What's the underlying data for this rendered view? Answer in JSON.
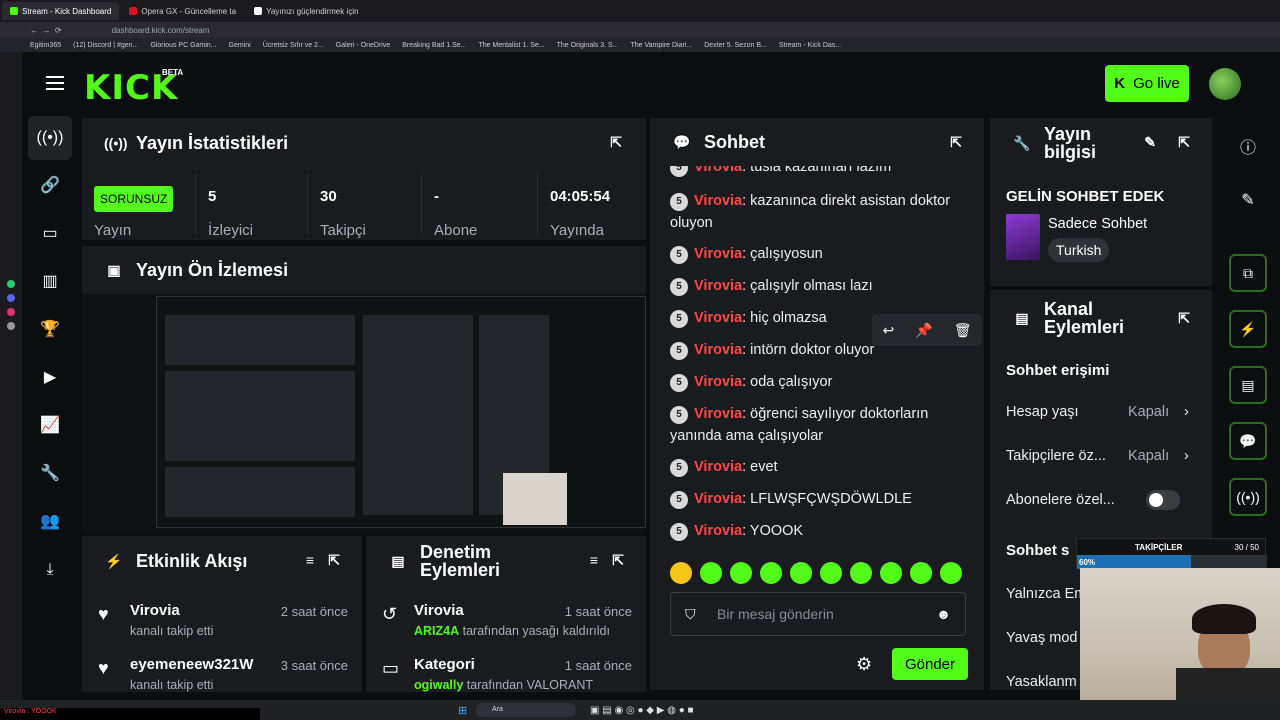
{
  "browser": {
    "tabs": [
      {
        "label": "Stream - Kick Dashboard",
        "active": true
      },
      {
        "label": "Opera GX - Güncelleme ta",
        "active": false
      },
      {
        "label": "Yayınızı güçlendirmek için",
        "active": false
      }
    ],
    "url": "dashboard.kick.com/stream",
    "bookmarks": [
      "Egitim365",
      "(12) Discord | #gen...",
      "Glorious PC Gamin...",
      "Gemini",
      "Ücretsiz Sıfır ve 2...",
      "Galeri - OneDrive",
      "Breaking Bad 1.Se...",
      "The Mentalist 1. Se...",
      "The Originals 3. S...",
      "The Vampire Diari...",
      "Dexter 5. Sezon B...",
      "Stream - Kick Das..."
    ]
  },
  "header": {
    "logo": "KICK",
    "logo_badge": "BETA",
    "go_live": "Go live"
  },
  "stats": {
    "title": "Yayın İstatistikleri",
    "status_badge": "SORUNSUZ",
    "status_label": "Yayın",
    "viewers_value": "5",
    "viewers_label": "İzleyici",
    "followers_value": "30",
    "followers_label": "Takipçi",
    "subs_value": "-",
    "subs_label": "Abone",
    "uptime_value": "04:05:54",
    "uptime_label": "Yayında"
  },
  "preview": {
    "title": "Yayın Ön İzlemesi"
  },
  "chat": {
    "title": "Sohbet",
    "badge": "5",
    "messages": [
      {
        "user": "Virovia",
        "text": ": tusla kazanırları lazım"
      },
      {
        "user": "Virovia",
        "text": ": kazanınca direkt asistan doktor oluyon"
      },
      {
        "user": "Virovia",
        "text": ": çalışıyosun"
      },
      {
        "user": "Virovia",
        "text": ": çalışıylr olması lazı"
      },
      {
        "user": "Virovia",
        "text": ": hiç olmazsa"
      },
      {
        "user": "Virovia",
        "text": ": intörn doktor oluyor"
      },
      {
        "user": "Virovia",
        "text": ": oda çalışıyor"
      },
      {
        "user": "Virovia",
        "text": ": öğrenci sayılıyor doktorların yanında ama çalışıyolar"
      },
      {
        "user": "Virovia",
        "text": ": evet"
      },
      {
        "user": "Virovia",
        "text": ": LFLWŞFÇWŞDÖWLDLE"
      },
      {
        "user": "Virovia",
        "text": ": YOOOK"
      }
    ],
    "input_placeholder": "Bir mesaj gönderin",
    "send": "Gönder"
  },
  "stream_info": {
    "title": "Yayın bilgisi",
    "stream_title": "GELİN SOHBET EDEK",
    "category": "Sadece Sohbet",
    "language": "Turkish"
  },
  "channel_actions": {
    "title": "Kanal Eylemleri",
    "chat_access": "Sohbet erişimi",
    "rows": [
      {
        "label": "Hesap yaşı",
        "value": "Kapalı"
      },
      {
        "label": "Takipçilere öz...",
        "value": "Kapalı"
      },
      {
        "label": "Abonelere özel...",
        "value": ""
      }
    ],
    "chat_settings": "Sohbet s",
    "rows2": [
      "Yalnızca Em",
      "Yavaş mod",
      "Yasaklanm"
    ]
  },
  "activity": {
    "title": "Etkinlik Akışı",
    "items": [
      {
        "name": "Virovia",
        "sub": "kanalı takip etti",
        "time": "2 saat önce"
      },
      {
        "name": "eyemeneew321W",
        "sub": "kanalı takip etti",
        "time": "3 saat önce"
      }
    ]
  },
  "moderation": {
    "title": "Denetim Eylemleri",
    "items": [
      {
        "name": "Virovia",
        "sub_user": "ARIZ4A",
        "sub": " tarafından yasağı kaldırıldı",
        "time": "1 saat önce"
      },
      {
        "name": "Kategori",
        "sub_user": "ogiwally",
        "sub": " tarafından VALORANT",
        "time": "1 saat önce"
      }
    ]
  },
  "overlay": {
    "follow_goal_label": "TAKİPÇİLER",
    "follow_goal_count": "30 / 50",
    "follow_goal_percent": "60%",
    "follow_goal_fraction": 0.6,
    "last_chat": "Virovia : YOOOK"
  },
  "taskbar": {
    "search": "Ara"
  },
  "colors": {
    "accent": "#53fc18",
    "username": "#ff4848",
    "panel": "#191b1f",
    "bg": "#0b0e0f"
  }
}
